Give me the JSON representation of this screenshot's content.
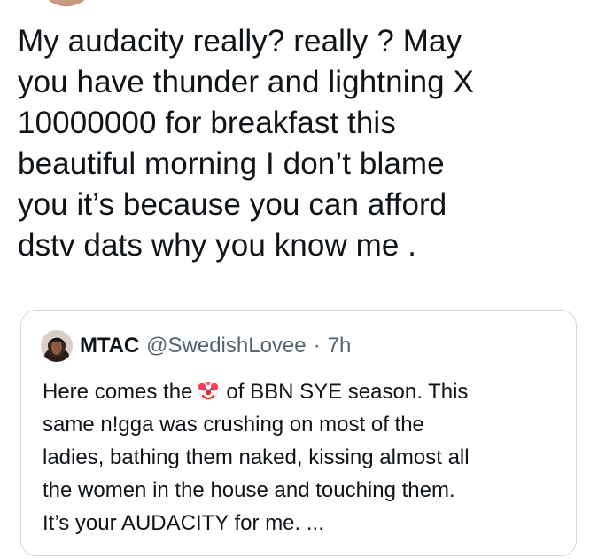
{
  "tweet": {
    "lines": [
      "My audacity really? really ? May",
      "you have thunder and lightning X",
      "10000000 for breakfast this",
      "beautiful morning I don’t blame",
      "you it’s because you can afford",
      "dstv dats why you know me ."
    ]
  },
  "quote_tweet": {
    "author_name": "MTAC",
    "author_handle": "@SwedishLovee",
    "separator": "·",
    "time": "7h",
    "lines": {
      "line1_prefix": "Here comes the",
      "line1_suffix": "of BBN SYE season. This",
      "line2": "same n!gga was crushing on most of the",
      "line3": "ladies, bathing them naked, kissing almost all",
      "line4": "the women in the house and touching them.",
      "line5": "It’s your AUDACITY for me. ..."
    },
    "icons": {
      "avatar": "profile-avatar-icon",
      "emoji": "clown-face-icon"
    }
  },
  "colors": {
    "primary_text": "#0f1419",
    "secondary_text": "#536471",
    "card_border": "#cfd9de"
  }
}
